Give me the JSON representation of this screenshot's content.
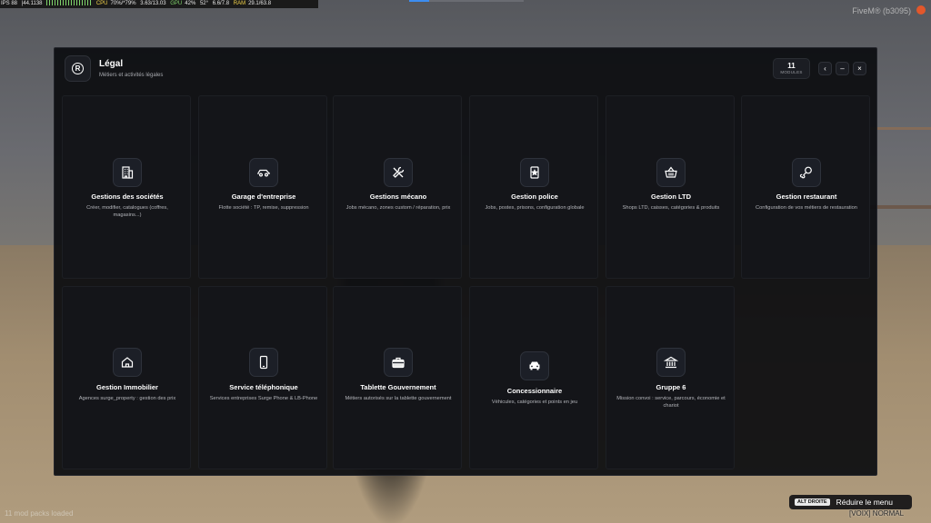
{
  "stats": {
    "fps": "IPS 88",
    "frame": "|44.1138",
    "cpu_label": "CPU",
    "cpu_value": "70%/*79%",
    "mem_value": "3.63/13.03",
    "gpu_label": "GPU",
    "gpu_value": "42%",
    "gpu_temp": "52°",
    "vram_value": "6.6/7.8",
    "ram_label": "RAM",
    "ram_value": "29.1/63.8"
  },
  "watermark": "FiveM® (b3095)",
  "panel": {
    "title": "Légal",
    "subtitle": "Métiers et activités légales",
    "logo_letter": "R",
    "counter_value": "11",
    "counter_label": "MODULES",
    "btn_back": "‹",
    "btn_minimize": "–",
    "btn_close": "×"
  },
  "cards": [
    {
      "title": "Gestions des sociétés",
      "desc": "Créer, modifier, catalogues (coffres, magasins...)",
      "icon": "building-icon"
    },
    {
      "title": "Garage d'entreprise",
      "desc": "Flotte société : TP, remise, suppression",
      "icon": "car-icon"
    },
    {
      "title": "Gestions mécano",
      "desc": "Jobs mécano, zones custom / réparation, prix",
      "icon": "wrench-screwdriver-icon"
    },
    {
      "title": "Gestion police",
      "desc": "Jobs, postes, prisons, configuration globale",
      "icon": "police-badge-icon"
    },
    {
      "title": "Gestion LTD",
      "desc": "Shops LTD, caisses, catégories & produits",
      "icon": "shopping-basket-icon"
    },
    {
      "title": "Gestion restaurant",
      "desc": "Configuration de vos métiers de restauration",
      "icon": "drumstick-icon"
    },
    {
      "title": "Gestion Immobilier",
      "desc": "Agences surge_property : gestion des prix",
      "icon": "house-icon"
    },
    {
      "title": "Service téléphonique",
      "desc": "Services entreprises Surge Phone & LB-Phone",
      "icon": "phone-icon"
    },
    {
      "title": "Tablette Gouvernement",
      "desc": "Métiers autorisés sur la tablette gouvernement",
      "icon": "briefcase-icon"
    },
    {
      "title": "Concessionnaire",
      "desc": "Véhicules, catégories et points en jeu",
      "icon": "car-front-icon"
    },
    {
      "title": "Gruppe 6",
      "desc": "Mission convoi : service, parcours, économie et chariot",
      "icon": "bank-icon"
    }
  ],
  "footer": {
    "mods_loaded": "11 mod packs loaded",
    "hint_key": "ALT DROITE",
    "hint_text": "Réduire le menu",
    "voice_status": "[VOIX] NORMAL"
  }
}
